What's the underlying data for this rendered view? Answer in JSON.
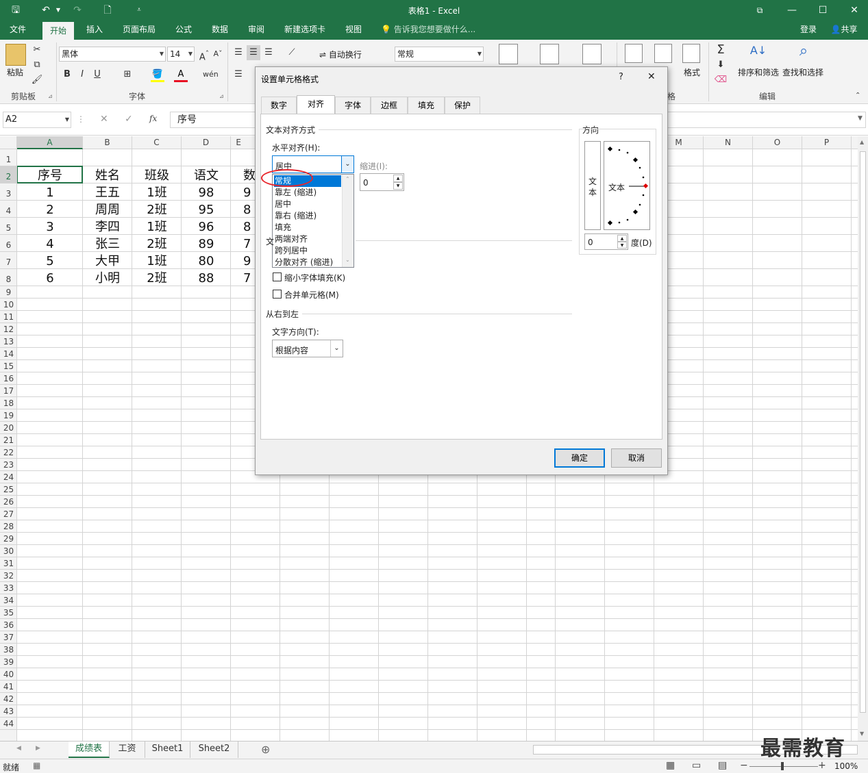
{
  "window": {
    "title": "表格1 - Excel",
    "signin": "登录",
    "share": "共享"
  },
  "tabs": [
    "文件",
    "开始",
    "插入",
    "页面布局",
    "公式",
    "数据",
    "审阅",
    "新建选项卡",
    "视图"
  ],
  "tell_me": "告诉我您想要做什么...",
  "ribbon": {
    "paste": "粘贴",
    "clipboard": "剪贴板",
    "font_name": "黑体",
    "font_size": "14",
    "font_group": "字体",
    "wrap_text": "自动换行",
    "number_format": "常规",
    "format": "格式",
    "sort_filter": "排序和筛选",
    "find_select": "查找和选择",
    "edit": "编辑",
    "cells_fragment": "格"
  },
  "formula_bar": {
    "name_box": "A2",
    "fx": "fx",
    "value": "序号"
  },
  "columns": [
    "A",
    "B",
    "C",
    "D",
    "E",
    "M",
    "N",
    "O",
    "P"
  ],
  "rows": [
    "1",
    "2",
    "3",
    "4",
    "5",
    "6",
    "7",
    "8",
    "9",
    "10",
    "11",
    "12",
    "13",
    "14",
    "15",
    "16",
    "17",
    "18",
    "19",
    "20",
    "21",
    "22",
    "23",
    "24",
    "25",
    "26",
    "27",
    "28",
    "29",
    "30",
    "31",
    "32",
    "33",
    "34",
    "35",
    "36",
    "37",
    "38",
    "39",
    "40",
    "41",
    "42",
    "43",
    "44"
  ],
  "table": {
    "headers": [
      "序号",
      "姓名",
      "班级",
      "语文",
      "数"
    ],
    "data": [
      [
        "1",
        "王五",
        "1班",
        "98",
        "9"
      ],
      [
        "2",
        "周周",
        "2班",
        "95",
        "8"
      ],
      [
        "3",
        "李四",
        "1班",
        "96",
        "8"
      ],
      [
        "4",
        "张三",
        "2班",
        "89",
        "7"
      ],
      [
        "5",
        "大甲",
        "1班",
        "80",
        "9"
      ],
      [
        "6",
        "小明",
        "2班",
        "88",
        "7"
      ]
    ]
  },
  "sheets": [
    "成绩表",
    "工资",
    "Sheet1",
    "Sheet2"
  ],
  "status": {
    "ready": "就绪",
    "zoom": "100%"
  },
  "watermark": "最需教育",
  "dialog": {
    "title": "设置单元格格式",
    "help": "?",
    "close": "✕",
    "tabs": [
      "数字",
      "对齐",
      "字体",
      "边框",
      "填充",
      "保护"
    ],
    "text_align_section": "文本对齐方式",
    "horizontal_label": "水平对齐(H):",
    "horizontal_value": "居中",
    "horizontal_options": [
      "常规",
      "靠左 (缩进)",
      "居中",
      "靠右 (缩进)",
      "填充",
      "两端对齐",
      "跨列居中",
      "分散对齐 (缩进)"
    ],
    "indent_label": "缩进(I):",
    "indent_value": "0",
    "text_control_fragment": "文",
    "shrink_to_fit": "缩小字体填充(K)",
    "merge_cells": "合并单元格(M)",
    "rtl_section": "从右到左",
    "text_direction_label": "文字方向(T):",
    "text_direction_value": "根据内容",
    "orientation_section": "方向",
    "vertical_text": "文本",
    "angle_text": "文本",
    "degree_value": "0",
    "degree_label": "度(D)",
    "ok": "确定",
    "cancel": "取消"
  }
}
